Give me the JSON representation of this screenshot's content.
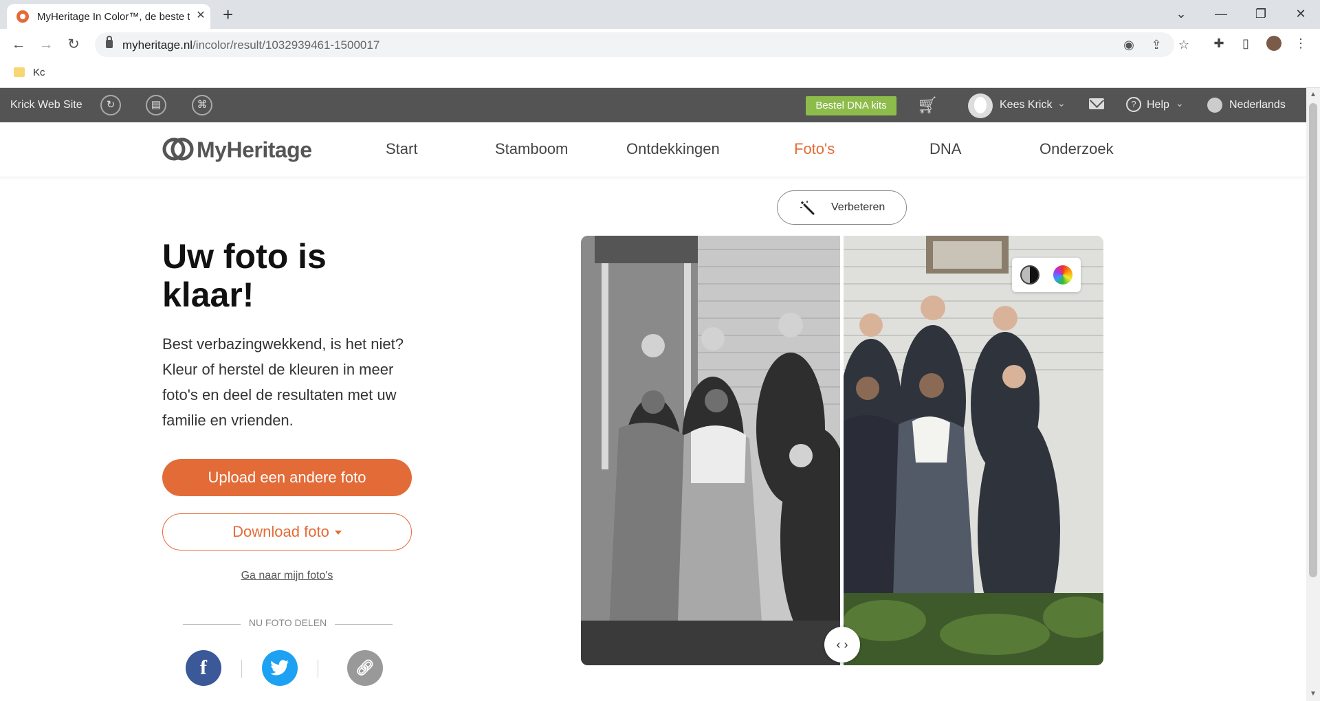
{
  "browser": {
    "tab_title": "MyHeritage In Color™, de beste t",
    "url_host": "myheritage.nl",
    "url_path": "/incolor/result/1032939461-1500017",
    "bookmark": "Kc"
  },
  "sitebar": {
    "site_name": "Krick Web Site",
    "dna_button": "Bestel DNA kits",
    "user_name": "Kees Krick",
    "help_label": "Help",
    "language": "Nederlands"
  },
  "nav": {
    "logo": "MyHeritage",
    "items": [
      "Start",
      "Stamboom",
      "Ontdekkingen",
      "Foto's",
      "DNA",
      "Onderzoek"
    ],
    "active_color": "#e36b37"
  },
  "main": {
    "heading": "Uw foto is klaar!",
    "body": "Best verbazingwekkend, is het niet? Kleur of herstel de kleuren in meer foto's en deel de resultaten met uw familie en vrienden.",
    "upload_button": "Upload een andere foto",
    "download_button": "Download foto",
    "my_photos_link": "Ga naar mijn foto's",
    "share_label": "NU FOTO DELEN",
    "enhance_button": "Verbeteren"
  },
  "colors": {
    "brand_orange": "#e36b37",
    "dna_green": "#8dbc4b",
    "facebook": "#3b5998",
    "twitter": "#1da1f2",
    "link_gray": "#777777"
  },
  "icons": {
    "share": [
      "facebook-icon",
      "twitter-icon",
      "link-icon"
    ],
    "compare_handle": "compare-arrows-icon",
    "color_modes": [
      "black-white-icon",
      "color-wheel-icon"
    ]
  }
}
